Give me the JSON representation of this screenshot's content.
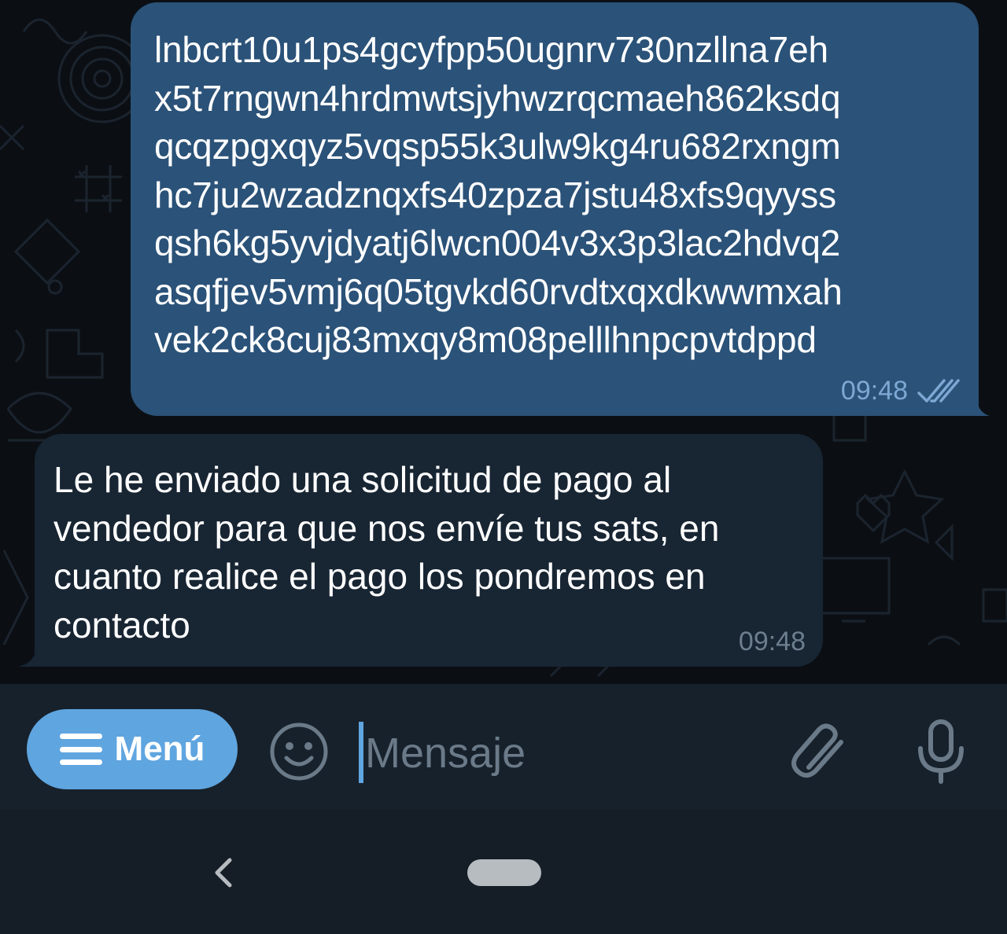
{
  "messages": [
    {
      "direction": "outgoing",
      "lines": [
        "lnbcrt10u1ps4gcyfpp50ugnrv730nzllna7eh",
        "x5t7rngwn4hrdmwtsjyhwzrqcmaeh862ksdq",
        "qcqzpgxqyz5vqsp55k3ulw9kg4ru682rxngm",
        "hc7ju2wzadznqxfs40zpza7jstu48xfs9qyyss",
        "qsh6kg5yvjdyatj6lwcn004v3x3p3lac2hdvq2",
        "asqfjev5vmj6q05tgvkd60rvdtxqxdkwwmxah",
        "vek2ck8cuj83mxqy8m08pelllhnpcpvtdppd"
      ],
      "time": "09:48",
      "status_icon": "double-check-icon",
      "color": "#2b5278"
    },
    {
      "direction": "incoming",
      "text": "Le he enviado una solicitud de pago al vendedor para que nos envíe tus sats, en cuanto realice el pago los pondremos en contacto",
      "time": "09:48",
      "color": "#182533"
    }
  ],
  "input_bar": {
    "menu_label": "Menú",
    "menu_icon": "hamburger-icon",
    "emoji_icon": "smiley-icon",
    "placeholder": "Mensaje",
    "attach_icon": "paperclip-icon",
    "mic_icon": "microphone-icon",
    "accent_color": "#5fa5e0"
  },
  "nav_bar": {
    "back_icon": "back-chevron-icon",
    "home_icon": "home-pill-icon"
  }
}
